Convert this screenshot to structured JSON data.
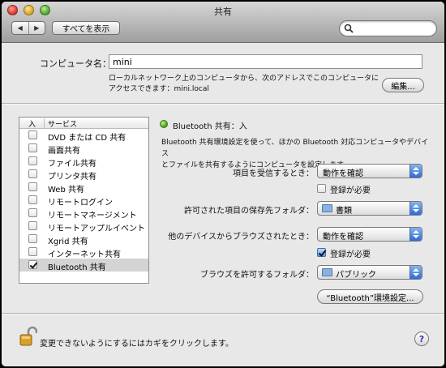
{
  "window": {
    "title": "共有"
  },
  "toolbar": {
    "show_all_label": "すべてを表示",
    "back_label": "◀",
    "forward_label": "▶",
    "search_placeholder": ""
  },
  "computer": {
    "name_label": "コンピュータ名：",
    "name_value": "mini",
    "note_line1": "ローカルネットワーク上のコンピュータから、次のアドレスでこのコンピュータに",
    "note_line2": "アクセスできます：mini.local",
    "edit_button": "編集..."
  },
  "services": {
    "col_on": "入",
    "col_service": "サービス",
    "items": [
      {
        "label": "DVD または CD 共有",
        "checked": false,
        "selected": false
      },
      {
        "label": "画面共有",
        "checked": false,
        "selected": false
      },
      {
        "label": "ファイル共有",
        "checked": false,
        "selected": false
      },
      {
        "label": "プリンタ共有",
        "checked": false,
        "selected": false
      },
      {
        "label": "Web 共有",
        "checked": false,
        "selected": false
      },
      {
        "label": "リモートログイン",
        "checked": false,
        "selected": false
      },
      {
        "label": "リモートマネージメント",
        "checked": false,
        "selected": false
      },
      {
        "label": "リモートアップルイベント",
        "checked": false,
        "selected": false
      },
      {
        "label": "Xgrid 共有",
        "checked": false,
        "selected": false
      },
      {
        "label": "インターネット共有",
        "checked": false,
        "selected": false
      },
      {
        "label": "Bluetooth 共有",
        "checked": true,
        "selected": true
      }
    ]
  },
  "detail": {
    "status": "Bluetooth 共有：入",
    "status_color": "#3e9c14",
    "desc_line1": "Bluetooth 共有環境設定を使って、ほかの Bluetooth 対応コンピュータやデバイス",
    "desc_line2": "とファイルを共有するようにコンピュータを設定します。",
    "receive_label": "項目を受信するとき：",
    "receive_value": "動作を確認",
    "receive_require_pairing": "登録が必要",
    "receive_require_pairing_checked": false,
    "folder_label": "許可された項目の保存先フォルダ：",
    "folder_value": "書類",
    "browse_label": "他のデバイスからブラウズされたとき：",
    "browse_value": "動作を確認",
    "browse_require_pairing": "登録が必要",
    "browse_require_pairing_checked": true,
    "browse_folder_label": "ブラウズを許可するフォルダ：",
    "browse_folder_value": "パブリック",
    "prefs_button": "“Bluetooth”環境設定..."
  },
  "footer": {
    "lock_text": "変更できないようにするにはカギをクリックします。",
    "help_label": "?"
  }
}
